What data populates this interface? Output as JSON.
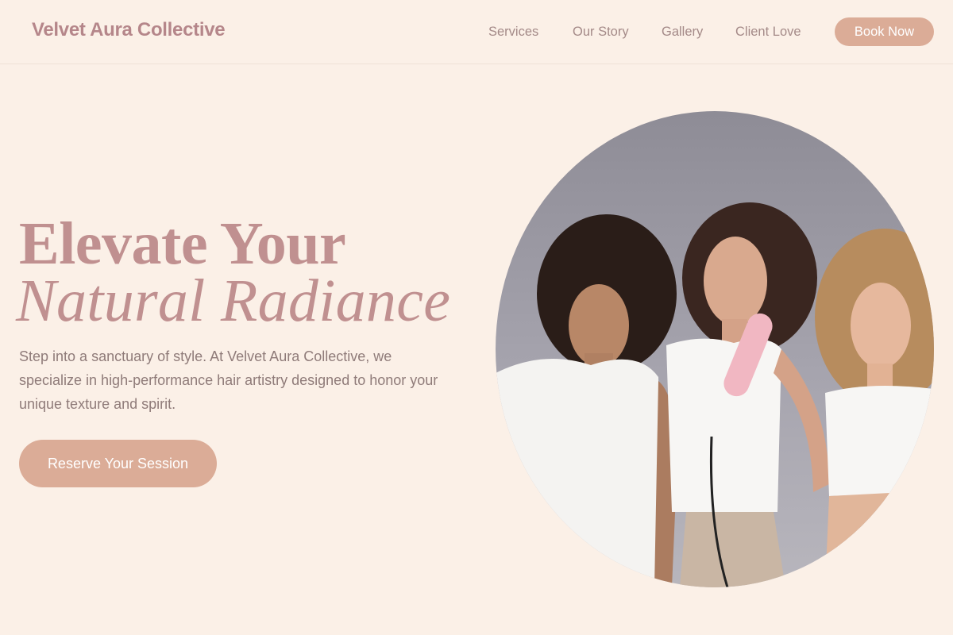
{
  "header": {
    "brand": "Velvet Aura Collective",
    "nav": [
      "Services",
      "Our Story",
      "Gallery",
      "Client Love"
    ],
    "cta": "Book Now"
  },
  "hero": {
    "headline_line1": "Elevate Your",
    "headline_line2": "Natural Radiance",
    "body": "Step into a sanctuary of style. At Velvet Aura Collective, we specialize in high-performance hair artistry designed to honor your unique texture and spirit.",
    "cta": "Reserve Your Session",
    "image_alt": "Three models in white tops, one holding a pink hair styling tool"
  },
  "colors": {
    "background": "#fbf0e7",
    "accent": "#dbac97",
    "headline": "#c09090",
    "brand": "#b5868a",
    "nav_text": "#a48a88",
    "body_text": "#8f7b79"
  }
}
